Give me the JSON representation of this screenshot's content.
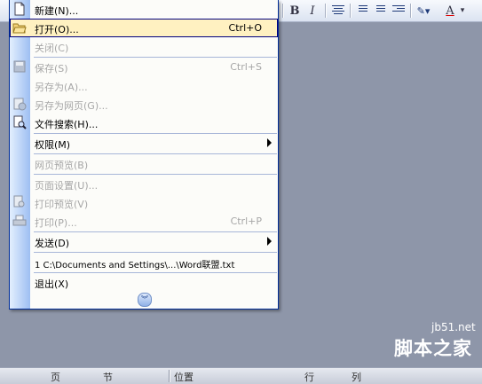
{
  "menu": {
    "items": [
      {
        "label": "新建(N)...",
        "shortcut": "",
        "icon": "new-doc-icon"
      },
      {
        "label": "打开(O)...",
        "shortcut": "Ctrl+O",
        "icon": "open-folder-icon"
      },
      {
        "label": "关闭(C)",
        "shortcut": "",
        "icon": ""
      },
      {
        "label": "保存(S)",
        "shortcut": "Ctrl+S",
        "icon": "save-icon"
      },
      {
        "label": "另存为(A)...",
        "shortcut": "",
        "icon": ""
      },
      {
        "label": "另存为网页(G)...",
        "shortcut": "",
        "icon": "web-page-icon"
      },
      {
        "label": "文件搜索(H)...",
        "shortcut": "",
        "icon": "file-search-icon"
      },
      {
        "label": "权限(M)",
        "shortcut": "",
        "icon": ""
      },
      {
        "label": "网页预览(B)",
        "shortcut": "",
        "icon": ""
      },
      {
        "label": "页面设置(U)...",
        "shortcut": "",
        "icon": ""
      },
      {
        "label": "打印预览(V)",
        "shortcut": "",
        "icon": "print-preview-icon"
      },
      {
        "label": "打印(P)...",
        "shortcut": "Ctrl+P",
        "icon": "print-icon"
      },
      {
        "label": "发送(D)",
        "shortcut": "",
        "icon": ""
      },
      {
        "label": "1 C:\\Documents and Settings\\...\\Word联盟.txt",
        "shortcut": "",
        "icon": ""
      },
      {
        "label": "退出(X)",
        "shortcut": "",
        "icon": ""
      }
    ],
    "expand_icon": "double-chevron-down-icon"
  },
  "toolbar": {
    "bold": "B",
    "italic": "I",
    "font_color": "A"
  },
  "statusbar": {
    "page": "页",
    "section": "节",
    "position": "位置",
    "line": "行",
    "column": "列"
  },
  "watermark": {
    "url": "jb51.net",
    "name": "脚本之家"
  },
  "colors": {
    "highlight": "#fff1c1",
    "menu_border": "#002d96",
    "workspace": "#8e96a9"
  }
}
